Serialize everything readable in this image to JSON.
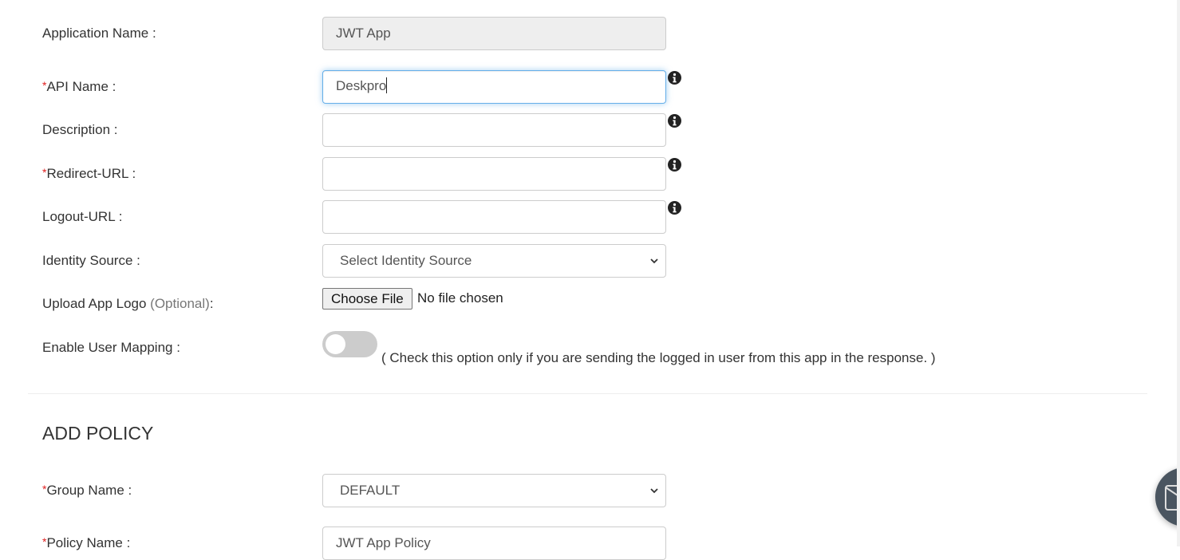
{
  "form": {
    "application_name": {
      "label": "Application Name :",
      "value": "JWT App",
      "readonly": true
    },
    "api_name": {
      "required_mark": "*",
      "label": "API Name :",
      "value": "Deskpro",
      "info_icon": "info-circle-icon"
    },
    "description": {
      "label": "Description :",
      "value": "",
      "info_icon": "info-circle-icon"
    },
    "redirect_url": {
      "required_mark": "*",
      "label": "Redirect-URL :",
      "value": "",
      "info_icon": "info-circle-icon"
    },
    "logout_url": {
      "label": "Logout-URL :",
      "value": "",
      "info_icon": "info-circle-icon"
    },
    "identity_source": {
      "label": "Identity Source :",
      "selected": "Select Identity Source"
    },
    "upload_logo": {
      "label": "Upload App Logo ",
      "optional": "(Optional)",
      "suffix": ":",
      "button": "Choose File",
      "status": "No file chosen"
    },
    "user_mapping": {
      "label": "Enable User Mapping :",
      "enabled": false,
      "hint": "( Check this option only if you are sending the logged in user from this app in the response. )"
    }
  },
  "policy": {
    "title": "ADD POLICY",
    "group_name": {
      "required_mark": "*",
      "label": "Group Name :",
      "selected": "DEFAULT"
    },
    "policy_name": {
      "required_mark": "*",
      "label": "Policy Name :",
      "value": "JWT App Policy"
    }
  },
  "floating_button": {
    "icon": "envelope-icon"
  },
  "colors": {
    "required": "#e02020",
    "focus": "#66afe9",
    "toggle_off": "#cccccc",
    "fab": "#4a5560"
  }
}
